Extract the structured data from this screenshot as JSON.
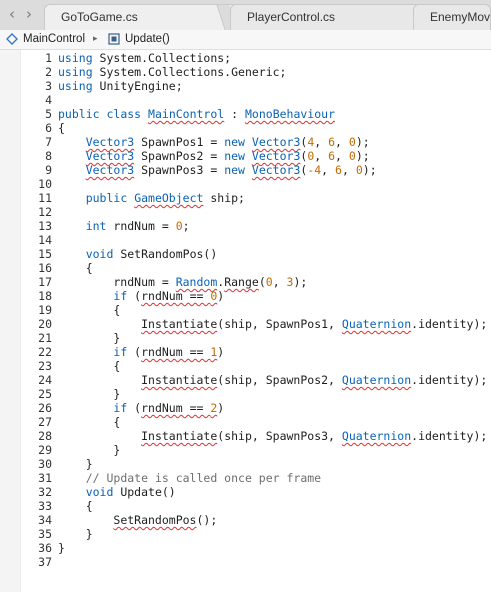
{
  "tabs": [
    {
      "label": "GoToGame.cs",
      "active": true
    },
    {
      "label": "PlayerControl.cs",
      "active": false
    },
    {
      "label": "EnemyMove",
      "active": false
    }
  ],
  "nav": {
    "back_glyph": "‹",
    "forward_glyph": "›"
  },
  "breadcrumb": {
    "class_name": "MainControl",
    "method_name": "Update()",
    "class_icon": "class-icon",
    "method_icon": "method-icon",
    "separator": "▸"
  },
  "colors": {
    "keyword": "#0a62b5",
    "number": "#c46a00",
    "comment": "#6e6e6e",
    "error_squiggle": "#e03030"
  },
  "code_lines": [
    [
      [
        "kw",
        "using"
      ],
      [
        "p",
        " System.Collections;"
      ]
    ],
    [
      [
        "kw",
        "using"
      ],
      [
        "p",
        " System.Collections.Generic;"
      ]
    ],
    [
      [
        "kw",
        "using"
      ],
      [
        "p",
        " UnityEngine;"
      ]
    ],
    [],
    [
      [
        "kw",
        "public"
      ],
      [
        "p",
        " "
      ],
      [
        "kw",
        "class"
      ],
      [
        "p",
        " "
      ],
      [
        "ty",
        "MainControl"
      ],
      [
        "p",
        " : "
      ],
      [
        "ty",
        "MonoBehaviour"
      ]
    ],
    [
      [
        "p",
        "{"
      ]
    ],
    [
      [
        "p",
        "    "
      ],
      [
        "ty",
        "Vector3"
      ],
      [
        "p",
        " SpawnPos1 = "
      ],
      [
        "kw",
        "new"
      ],
      [
        "p",
        " "
      ],
      [
        "ty",
        "Vector3"
      ],
      [
        "p",
        "("
      ],
      [
        "nm",
        "4"
      ],
      [
        "p",
        ", "
      ],
      [
        "nm",
        "6"
      ],
      [
        "p",
        ", "
      ],
      [
        "nm",
        "0"
      ],
      [
        "p",
        ");"
      ]
    ],
    [
      [
        "p",
        "    "
      ],
      [
        "ty",
        "Vector3"
      ],
      [
        "p",
        " SpawnPos2 = "
      ],
      [
        "kw",
        "new"
      ],
      [
        "p",
        " "
      ],
      [
        "ty",
        "Vector3"
      ],
      [
        "p",
        "("
      ],
      [
        "nm",
        "0"
      ],
      [
        "p",
        ", "
      ],
      [
        "nm",
        "6"
      ],
      [
        "p",
        ", "
      ],
      [
        "nm",
        "0"
      ],
      [
        "p",
        ");"
      ]
    ],
    [
      [
        "p",
        "    "
      ],
      [
        "ty",
        "Vector3"
      ],
      [
        "p",
        " SpawnPos3 = "
      ],
      [
        "kw",
        "new"
      ],
      [
        "p",
        " "
      ],
      [
        "ty",
        "Vector3"
      ],
      [
        "p",
        "("
      ],
      [
        "nm",
        "-4"
      ],
      [
        "p",
        ", "
      ],
      [
        "nm",
        "6"
      ],
      [
        "p",
        ", "
      ],
      [
        "nm",
        "0"
      ],
      [
        "p",
        ");"
      ]
    ],
    [],
    [
      [
        "p",
        "    "
      ],
      [
        "kw",
        "public"
      ],
      [
        "p",
        " "
      ],
      [
        "ty",
        "GameObject"
      ],
      [
        "p",
        " ship;"
      ]
    ],
    [],
    [
      [
        "p",
        "    "
      ],
      [
        "kt",
        "int"
      ],
      [
        "p",
        " rndNum = "
      ],
      [
        "nm",
        "0"
      ],
      [
        "p",
        ";"
      ]
    ],
    [],
    [
      [
        "p",
        "    "
      ],
      [
        "kt",
        "void"
      ],
      [
        "p",
        " SetRandomPos()"
      ]
    ],
    [
      [
        "p",
        "    {"
      ]
    ],
    [
      [
        "p",
        "        rndNum = "
      ],
      [
        "ty",
        "Random"
      ],
      [
        "p",
        "."
      ],
      [
        "sq",
        "Range"
      ],
      [
        "p",
        "("
      ],
      [
        "nm",
        "0"
      ],
      [
        "p",
        ", "
      ],
      [
        "nm",
        "3"
      ],
      [
        "p",
        ");"
      ]
    ],
    [
      [
        "p",
        "        "
      ],
      [
        "kw",
        "if"
      ],
      [
        "p",
        " ("
      ],
      [
        "sq",
        "rndNum == "
      ],
      [
        "ns",
        "0"
      ],
      [
        "p",
        ")"
      ]
    ],
    [
      [
        "p",
        "        {"
      ]
    ],
    [
      [
        "p",
        "            "
      ],
      [
        "sq",
        "Instantiate"
      ],
      [
        "p",
        "(ship, SpawnPos1, "
      ],
      [
        "ty",
        "Quaternion"
      ],
      [
        "p",
        ".identity);"
      ]
    ],
    [
      [
        "p",
        "        }"
      ]
    ],
    [
      [
        "p",
        "        "
      ],
      [
        "kw",
        "if"
      ],
      [
        "p",
        " ("
      ],
      [
        "sq",
        "rndNum == "
      ],
      [
        "ns",
        "1"
      ],
      [
        "p",
        ")"
      ]
    ],
    [
      [
        "p",
        "        {"
      ]
    ],
    [
      [
        "p",
        "            "
      ],
      [
        "sq",
        "Instantiate"
      ],
      [
        "p",
        "(ship, SpawnPos2, "
      ],
      [
        "ty",
        "Quaternion"
      ],
      [
        "p",
        ".identity);"
      ]
    ],
    [
      [
        "p",
        "        }"
      ]
    ],
    [
      [
        "p",
        "        "
      ],
      [
        "kw",
        "if"
      ],
      [
        "p",
        " ("
      ],
      [
        "sq",
        "rndNum == "
      ],
      [
        "ns",
        "2"
      ],
      [
        "p",
        ")"
      ]
    ],
    [
      [
        "p",
        "        {"
      ]
    ],
    [
      [
        "p",
        "            "
      ],
      [
        "sq",
        "Instantiate"
      ],
      [
        "p",
        "(ship, SpawnPos3, "
      ],
      [
        "ty",
        "Quaternion"
      ],
      [
        "p",
        ".identity);"
      ]
    ],
    [
      [
        "p",
        "        }"
      ]
    ],
    [
      [
        "p",
        "    }"
      ]
    ],
    [
      [
        "p",
        "    "
      ],
      [
        "cm",
        "// Update is called once per frame"
      ]
    ],
    [
      [
        "p",
        "    "
      ],
      [
        "kw",
        "void"
      ],
      [
        "p",
        " Update()"
      ]
    ],
    [
      [
        "p",
        "    {"
      ]
    ],
    [
      [
        "p",
        "        "
      ],
      [
        "sq",
        "SetRandomPos"
      ],
      [
        "p",
        "();"
      ]
    ],
    [
      [
        "p",
        "    }"
      ]
    ],
    [
      [
        "p",
        "}"
      ]
    ],
    []
  ]
}
